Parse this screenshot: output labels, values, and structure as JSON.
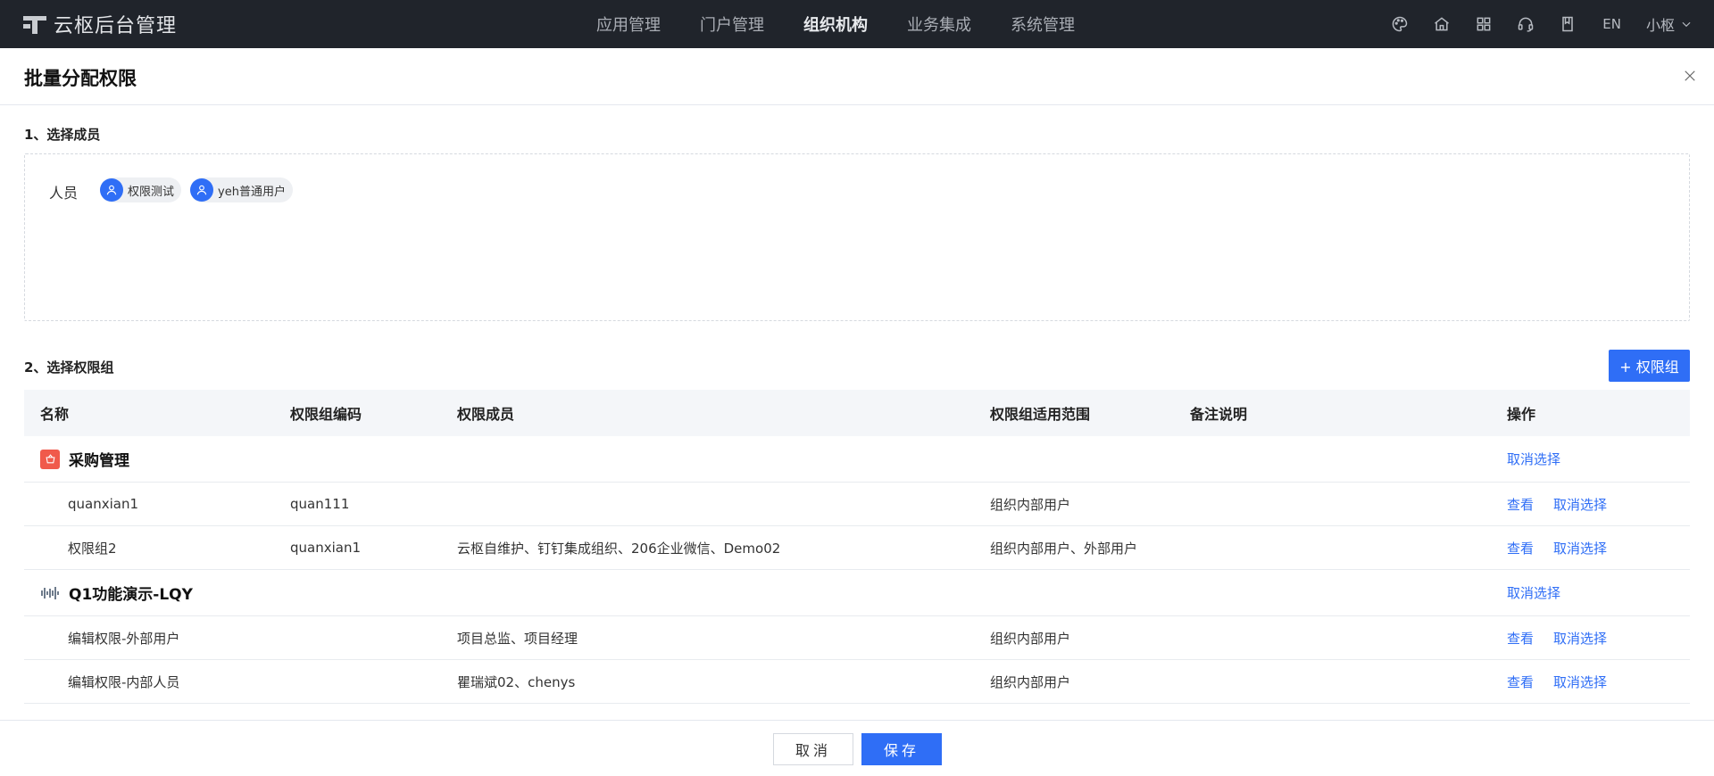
{
  "topbar": {
    "app_title": "云枢后台管理",
    "nav": [
      {
        "label": "应用管理",
        "active": false
      },
      {
        "label": "门户管理",
        "active": false
      },
      {
        "label": "组织机构",
        "active": true
      },
      {
        "label": "业务集成",
        "active": false
      },
      {
        "label": "系统管理",
        "active": false
      }
    ],
    "tools": [
      "palette-icon",
      "home-icon",
      "apps-grid-icon",
      "headset-icon",
      "book-icon"
    ],
    "lang": "EN",
    "user": "小枢"
  },
  "drawer": {
    "title": "批量分配权限"
  },
  "members": {
    "section_title": "1、选择成员",
    "label": "人员",
    "chips": [
      "权限测试",
      "yeh普通用户"
    ]
  },
  "groups": {
    "section_title": "2、选择权限组",
    "add_label": "+ 权限组",
    "columns": [
      "名称",
      "权限组编码",
      "权限成员",
      "权限组适用范围",
      "备注说明",
      "操作"
    ],
    "view_label": "查看",
    "deselect_label": "取消选择",
    "apps": [
      {
        "name": "采购管理",
        "icon": "shopping-basket-icon",
        "rows": [
          {
            "name": "quanxian1",
            "code": "quan111",
            "members": "",
            "scope": "组织内部用户",
            "remark": ""
          },
          {
            "name": "权限组2",
            "code": "quanxian1",
            "members": "云枢自维护、钉钉集成组织、206企业微信、Demo02",
            "scope": "组织内部用户、外部用户",
            "remark": ""
          }
        ]
      },
      {
        "name": "Q1功能演示-LQY",
        "icon": "waveform-icon",
        "rows": [
          {
            "name": "编辑权限-外部用户",
            "code": "",
            "members": "项目总监、项目经理",
            "scope": "组织内部用户",
            "remark": ""
          },
          {
            "name": "编辑权限-内部人员",
            "code": "",
            "members": "瞿瑞斌02、chenys",
            "scope": "组织内部用户",
            "remark": ""
          }
        ]
      }
    ]
  },
  "footer": {
    "cancel_label": "取消",
    "save_label": "保存"
  },
  "colors": {
    "primary": "#2f6ef6",
    "topbar_bg": "#20242b",
    "app_icon_red": "#f05a4b"
  }
}
